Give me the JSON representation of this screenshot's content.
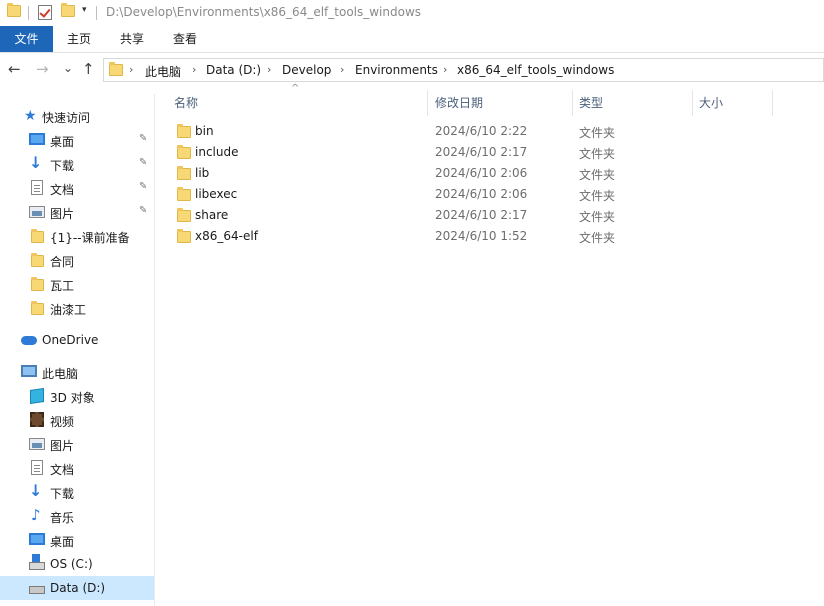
{
  "window": {
    "title": "D:\\Develop\\Environments\\x86_64_elf_tools_windows",
    "quick_access_dropdown": "▾"
  },
  "ribbon": {
    "tabs": [
      {
        "label": "文件"
      },
      {
        "label": "主页"
      },
      {
        "label": "共享"
      },
      {
        "label": "查看"
      }
    ]
  },
  "nav": {
    "back": "←",
    "forward": "→",
    "recent": "⌄",
    "up": "↑"
  },
  "address": {
    "crumbs": [
      "此电脑",
      "Data (D:)",
      "Develop",
      "Environments",
      "x86_64_elf_tools_windows"
    ],
    "separator": "›"
  },
  "sidebar": {
    "quick_access": {
      "label": "快速访问",
      "icon": "star-icon"
    },
    "pinned": [
      {
        "label": "桌面",
        "icon": "desktop-icon"
      },
      {
        "label": "下载",
        "icon": "download-icon"
      },
      {
        "label": "文档",
        "icon": "document-icon"
      },
      {
        "label": "图片",
        "icon": "pictures-icon"
      }
    ],
    "folders": [
      {
        "label": "{1}--课前准备",
        "icon": "folder-icon"
      },
      {
        "label": "合同",
        "icon": "folder-icon"
      },
      {
        "label": "瓦工",
        "icon": "folder-icon"
      },
      {
        "label": "油漆工",
        "icon": "folder-icon"
      }
    ],
    "onedrive": {
      "label": "OneDrive",
      "icon": "onedrive-icon"
    },
    "this_pc": {
      "label": "此电脑",
      "icon": "computer-icon"
    },
    "pc_items": [
      {
        "label": "3D 对象",
        "icon": "3d-objects-icon"
      },
      {
        "label": "视频",
        "icon": "video-icon"
      },
      {
        "label": "图片",
        "icon": "pictures-icon"
      },
      {
        "label": "文档",
        "icon": "document-icon"
      },
      {
        "label": "下载",
        "icon": "download-icon"
      },
      {
        "label": "音乐",
        "icon": "music-icon"
      },
      {
        "label": "桌面",
        "icon": "desktop-icon"
      },
      {
        "label": "OS (C:)",
        "icon": "drive-icon"
      },
      {
        "label": "Data (D:)",
        "icon": "drive-icon",
        "selected": true
      }
    ],
    "pin_glyph": "📌"
  },
  "columns": {
    "name": "名称",
    "modified": "修改日期",
    "type": "类型",
    "size": "大小",
    "sort_indicator": "^"
  },
  "files": [
    {
      "name": "bin",
      "modified": "2024/6/10 2:22",
      "type": "文件夹"
    },
    {
      "name": "include",
      "modified": "2024/6/10 2:17",
      "type": "文件夹"
    },
    {
      "name": "lib",
      "modified": "2024/6/10 2:06",
      "type": "文件夹"
    },
    {
      "name": "libexec",
      "modified": "2024/6/10 2:06",
      "type": "文件夹"
    },
    {
      "name": "share",
      "modified": "2024/6/10 2:17",
      "type": "文件夹"
    },
    {
      "name": "x86_64-elf",
      "modified": "2024/6/10 1:52",
      "type": "文件夹"
    }
  ],
  "colors": {
    "file_tab": "#1e66b8",
    "selection": "#cce8ff",
    "folder": "#f8d775",
    "accent": "#2d7bd6"
  }
}
